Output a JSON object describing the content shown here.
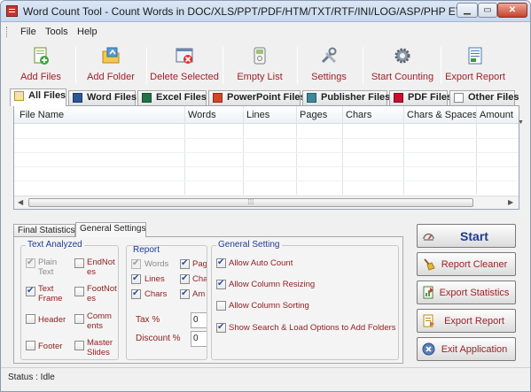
{
  "window": {
    "title": "Word Count Tool - Count Words in DOC/XLS/PPT/PDF/HTM/TXT/RTF/INI/LOG/ASP/PHP ETC."
  },
  "menu": [
    "File",
    "Tools",
    "Help"
  ],
  "toolbar": [
    {
      "label": "Add Files",
      "icon": "add-files-icon"
    },
    {
      "label": "Add Folder",
      "icon": "add-folder-icon"
    },
    {
      "label": "Delete Selected",
      "icon": "delete-icon"
    },
    {
      "label": "Empty List",
      "icon": "empty-list-icon"
    },
    {
      "label": "Settings",
      "icon": "settings-icon"
    },
    {
      "label": "Start Counting",
      "icon": "gear-icon"
    },
    {
      "label": "Export Report",
      "icon": "export-icon"
    }
  ],
  "tabs": [
    "All Files",
    "Word Files",
    "Excel Files",
    "PowerPoint Files",
    "Publisher Files",
    "PDF Files",
    "Other Files"
  ],
  "table": {
    "columns": [
      "File Name",
      "Words",
      "Lines",
      "Pages",
      "Chars",
      "Chars & Spaces",
      "Amount"
    ],
    "rows": []
  },
  "bottom_tabs": [
    "Final Statistics",
    "General Settings"
  ],
  "text_analyzed": {
    "title": "Text Analyzed",
    "items": [
      {
        "label": "Plain\nText",
        "checked": true,
        "enabled": false
      },
      {
        "label": "EndNot\nes",
        "checked": false,
        "enabled": true
      },
      {
        "label": "Text\nFrame",
        "checked": true,
        "enabled": true
      },
      {
        "label": "FootNot\nes",
        "checked": false,
        "enabled": true
      },
      {
        "label": "Header",
        "checked": false,
        "enabled": true
      },
      {
        "label": "Comm\nents",
        "checked": false,
        "enabled": true
      },
      {
        "label": "Footer",
        "checked": false,
        "enabled": true
      },
      {
        "label": "Master\nSlides",
        "checked": false,
        "enabled": true
      }
    ]
  },
  "report": {
    "title": "Report",
    "items": [
      {
        "label": "Words",
        "checked": true,
        "enabled": false
      },
      {
        "label": "Pag",
        "checked": true,
        "enabled": true
      },
      {
        "label": "Lines",
        "checked": true,
        "enabled": true
      },
      {
        "label": "Cha",
        "checked": true,
        "enabled": true
      },
      {
        "label": "Chars",
        "checked": true,
        "enabled": true
      },
      {
        "label": "Am",
        "checked": true,
        "enabled": true
      }
    ],
    "tax_label": "Tax %",
    "tax_value": "0",
    "discount_label": "Discount %",
    "discount_value": "0"
  },
  "general_setting": {
    "title": "General Setting",
    "items": [
      {
        "label": "Allow Auto Count",
        "checked": true
      },
      {
        "label": "Allow Column Resizing",
        "checked": true
      },
      {
        "label": "Allow Column Sorting",
        "checked": false
      },
      {
        "label": "Show Search & Load Options to Add Folders",
        "checked": true
      }
    ]
  },
  "side_buttons": [
    {
      "label": "Start",
      "icon": "speedometer-icon"
    },
    {
      "label": "Report Cleaner",
      "icon": "broom-icon"
    },
    {
      "label": "Export Statistics",
      "icon": "export-statistics-icon"
    },
    {
      "label": "Export Report",
      "icon": "export-report-icon"
    },
    {
      "label": "Exit Application",
      "icon": "exit-icon"
    }
  ],
  "status": "Status : Idle",
  "colors": {
    "accent_text": "#a0202a",
    "group_title": "#1f3a93",
    "label": "#8e1d1d"
  }
}
